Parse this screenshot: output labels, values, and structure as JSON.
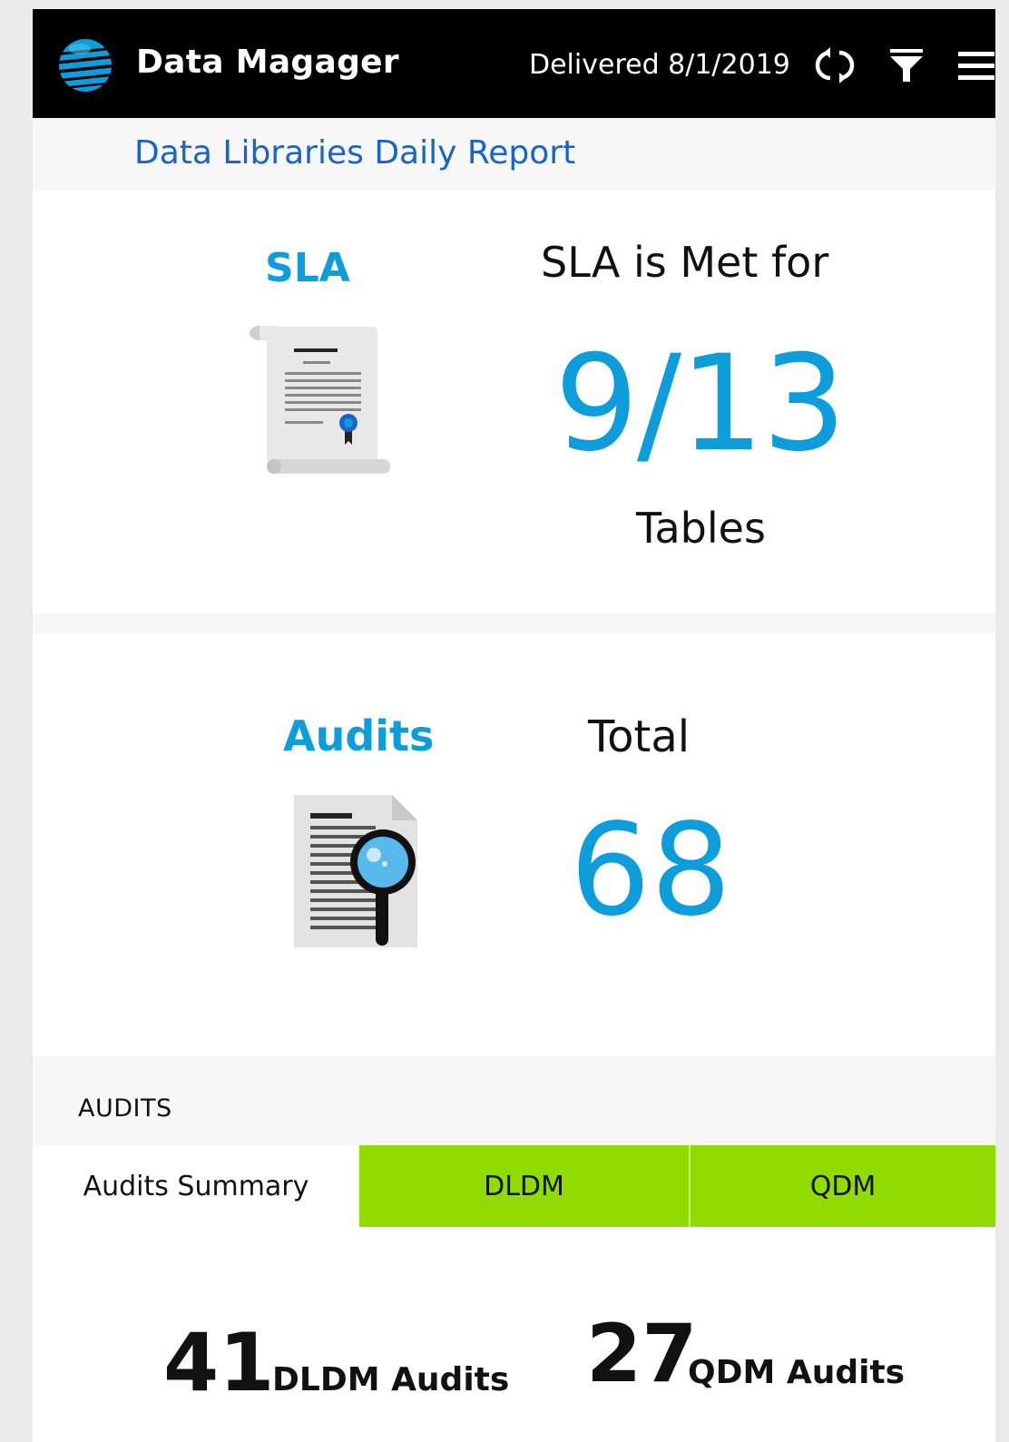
{
  "header": {
    "app_title": "Data Magager",
    "delivered": "Delivered 8/1/2019",
    "icons": [
      "att-globe-icon",
      "refresh-icon",
      "filter-icon",
      "menu-icon"
    ]
  },
  "report": {
    "title": "Data Libraries Daily Report"
  },
  "sla": {
    "label": "SLA",
    "heading": "SLA is Met for",
    "value": "9/13",
    "unit": "Tables"
  },
  "audits_card": {
    "label": "Audits",
    "heading": "Total",
    "value": "68"
  },
  "audits_section": {
    "label": "AUDITS",
    "tabs": [
      {
        "label": "Audits Summary",
        "active": true
      },
      {
        "label": "DLDM",
        "active": false
      },
      {
        "label": "QDM",
        "active": false
      }
    ],
    "summary": {
      "dldm_count": "41",
      "dldm_label": "DLDM Audits",
      "qdm_count": "27",
      "qdm_label": "QDM Audits"
    }
  },
  "colors": {
    "header_bg": "#000000",
    "accent_blue": "#0d9ddb",
    "link_blue": "#1a64c7",
    "tab_green": "#91dc00"
  }
}
